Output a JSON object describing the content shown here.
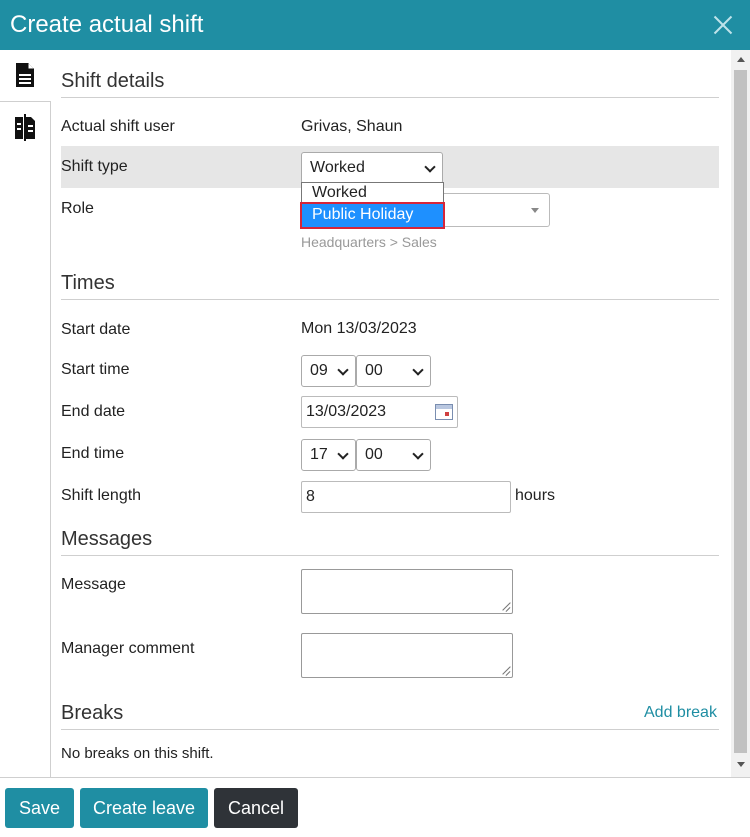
{
  "dialog": {
    "title": "Create actual shift"
  },
  "sections": {
    "shift_details": "Shift details",
    "times": "Times",
    "messages": "Messages",
    "breaks": "Breaks"
  },
  "fields": {
    "actual_shift_user": {
      "label": "Actual shift user",
      "value": "Grivas, Shaun"
    },
    "shift_type": {
      "label": "Shift type",
      "value": "Worked",
      "options": [
        "Worked",
        "Public Holiday"
      ],
      "highlighted_option": "Public Holiday"
    },
    "role": {
      "label": "Role",
      "hint": "Headquarters > Sales"
    },
    "start_date": {
      "label": "Start date",
      "value": "Mon 13/03/2023"
    },
    "start_time": {
      "label": "Start time",
      "hour": "09",
      "minute": "00"
    },
    "end_date": {
      "label": "End date",
      "value": "13/03/2023"
    },
    "end_time": {
      "label": "End time",
      "hour": "17",
      "minute": "00"
    },
    "shift_length": {
      "label": "Shift length",
      "value": "8",
      "unit": "hours"
    },
    "message": {
      "label": "Message"
    },
    "manager_comment": {
      "label": "Manager comment"
    }
  },
  "breaks": {
    "add_link": "Add break",
    "empty_text": "No breaks on this shift."
  },
  "footer": {
    "save": "Save",
    "create_leave": "Create leave",
    "cancel": "Cancel"
  },
  "colors": {
    "primary": "#1f8ea3",
    "cancel": "#2f3338",
    "selected_option": "#1e90ff",
    "focus_ring": "#d6263a"
  },
  "icons": [
    "document-icon",
    "documents-compare-icon",
    "close-icon",
    "calendar-icon",
    "chevron-down-icon"
  ]
}
